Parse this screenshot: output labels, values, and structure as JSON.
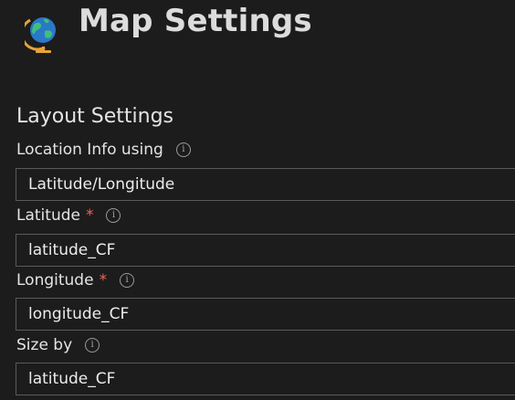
{
  "header": {
    "title": "Map Settings",
    "icon": "globe-icon"
  },
  "section": {
    "title": "Layout Settings"
  },
  "fields": {
    "location": {
      "label": "Location Info using",
      "value": "Latitude/Longitude",
      "required": false
    },
    "latitude": {
      "label": "Latitude",
      "required_mark": "*",
      "value": "latitude_CF"
    },
    "longitude": {
      "label": "Longitude",
      "required_mark": "*",
      "value": "longitude_CF"
    },
    "size_by": {
      "label": "Size by",
      "value": "latitude_CF",
      "required": false
    }
  },
  "info_icon_glyph": "i",
  "colors": {
    "background": "#1c1c1c",
    "text": "#e4e4e4",
    "required": "#f0635a",
    "field_border": "#5a5a5a"
  }
}
